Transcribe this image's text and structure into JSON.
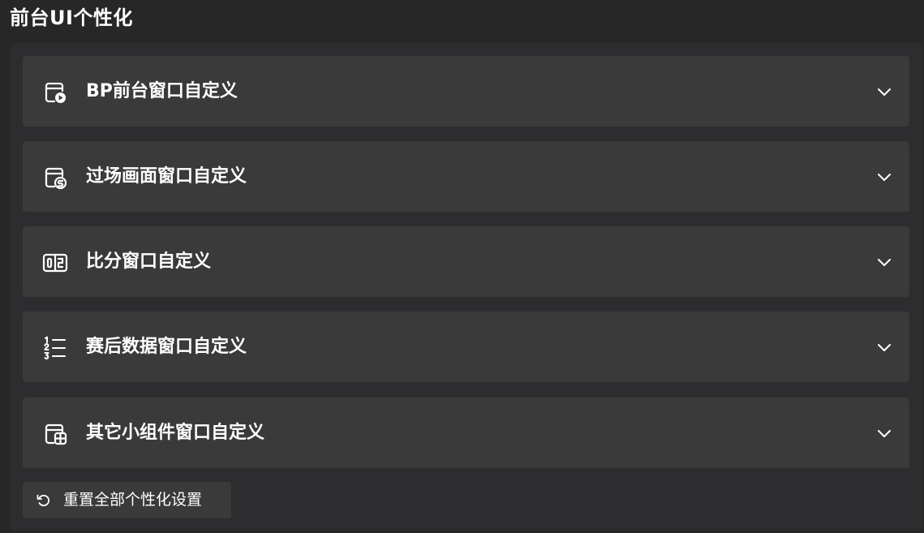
{
  "page": {
    "title": "前台UI个性化"
  },
  "sections": [
    {
      "label": "BP前台窗口自定义",
      "icon": "window-play-icon"
    },
    {
      "label": "过场画面窗口自定义",
      "icon": "window-transition-icon"
    },
    {
      "label": "比分窗口自定义",
      "icon": "score-columns-icon"
    },
    {
      "label": "赛后数据窗口自定义",
      "icon": "numbered-list-icon"
    },
    {
      "label": "其它小组件窗口自定义",
      "icon": "window-widgets-icon"
    }
  ],
  "reset": {
    "label": "重置全部个性化设置",
    "icon": "undo-icon"
  },
  "colors": {
    "background": "#272727",
    "panel": "#2d2d30",
    "section": "#3a3a3b",
    "text": "#ffffff"
  }
}
